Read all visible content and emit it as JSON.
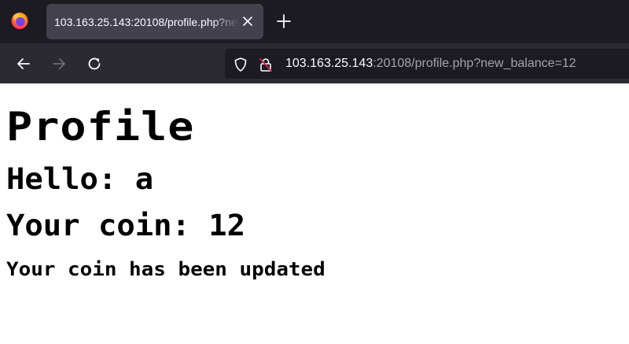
{
  "browser": {
    "tab": {
      "title": "103.163.25.143:20108/profile.php?new_balance=12"
    },
    "url": {
      "host": "103.163.25.143",
      "rest": ":20108/profile.php?new_balance=12"
    },
    "colors": {
      "tabstrip_bg": "#1c1b22",
      "active_tab_bg": "#42414d",
      "toolbar_bg": "#2b2a33",
      "urlbar_bg": "#1c1b22",
      "insecure_lock_slash": "#e22850"
    }
  },
  "page": {
    "heading": "Profile",
    "greeting": "Hello: a",
    "coin_line": "Your coin: 12",
    "status_message": "Your coin has been updated"
  }
}
